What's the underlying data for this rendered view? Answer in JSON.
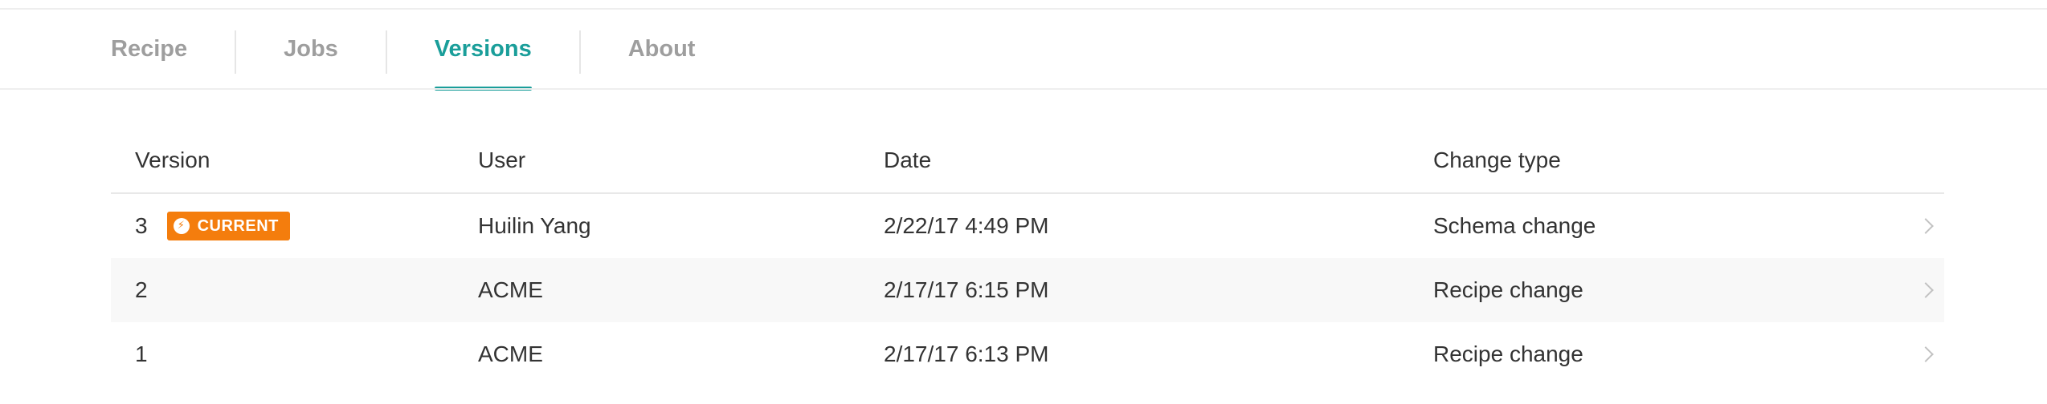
{
  "tabs": [
    {
      "label": "Recipe",
      "active": false
    },
    {
      "label": "Jobs",
      "active": false
    },
    {
      "label": "Versions",
      "active": true
    },
    {
      "label": "About",
      "active": false
    }
  ],
  "table": {
    "headers": {
      "version": "Version",
      "user": "User",
      "date": "Date",
      "change_type": "Change type"
    },
    "rows": [
      {
        "version": "3",
        "badge": "CURRENT",
        "user": "Huilin Yang",
        "date": "2/22/17 4:49 PM",
        "change_type": "Schema change"
      },
      {
        "version": "2",
        "user": "ACME",
        "date": "2/17/17 6:15 PM",
        "change_type": "Recipe change"
      },
      {
        "version": "1",
        "user": "ACME",
        "date": "2/17/17 6:13 PM",
        "change_type": "Recipe change"
      }
    ]
  },
  "icons": {
    "badge": "lightning-bolt-icon",
    "row_arrow": "chevron-right-icon"
  },
  "colors": {
    "accent": "#1a9e9a",
    "badge": "#f47d0d",
    "tab_inactive": "#9e9e9e"
  }
}
